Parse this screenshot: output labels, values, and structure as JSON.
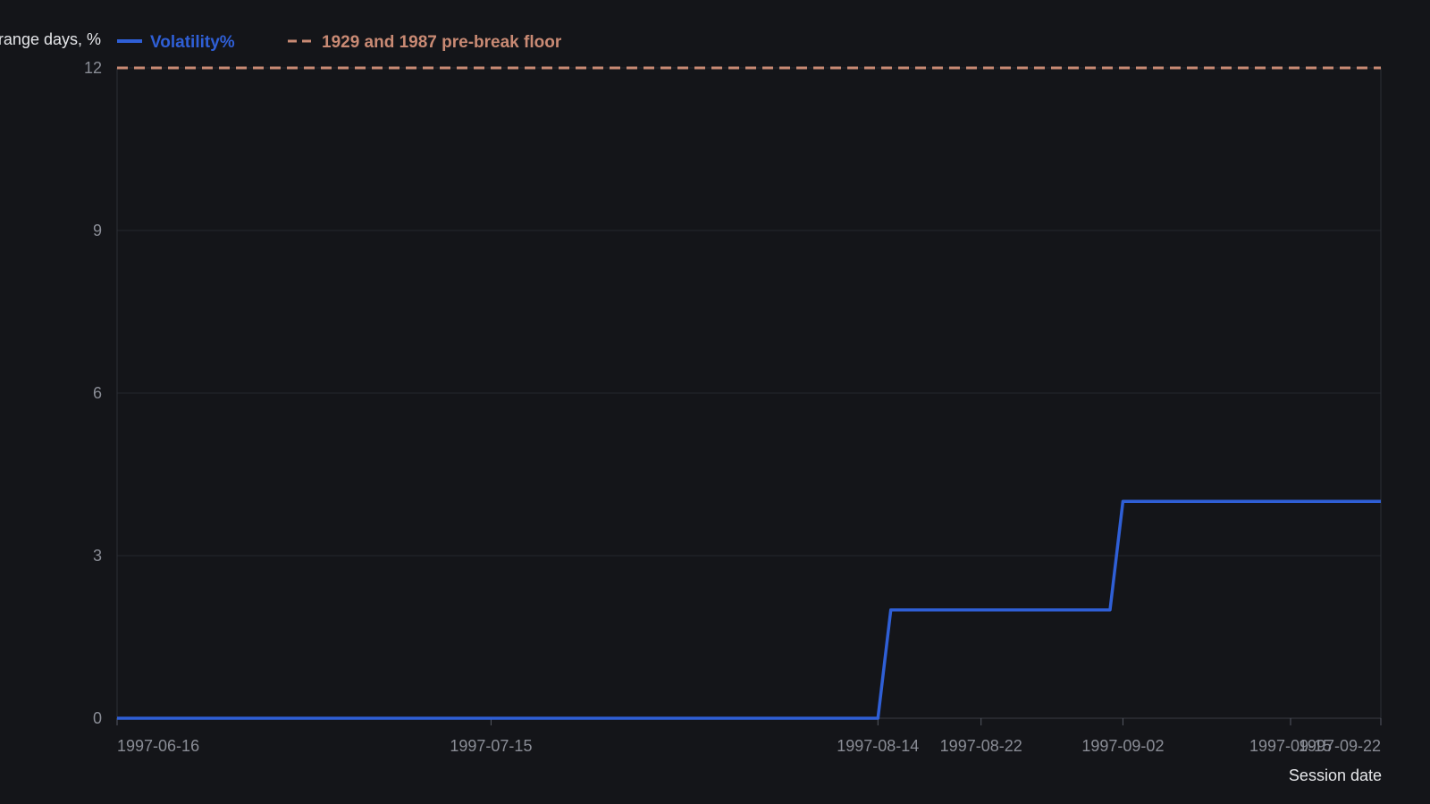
{
  "chart_data": {
    "type": "line",
    "ylabel": "Share of limit-range days, %",
    "xlabel": "Session date",
    "ylim": [
      0,
      12
    ],
    "yticks": [
      0,
      3,
      6,
      9,
      12
    ],
    "xticks": [
      "1997-06-16",
      "1997-07-15",
      "1997-08-14",
      "1997-08-22",
      "1997-09-02",
      "1997-09-15",
      "1997-09-22"
    ],
    "grid": true,
    "legend_position": "top-left",
    "step": true,
    "series": [
      {
        "name": "Volatility%",
        "color": "#2f5fd6",
        "style": "solid",
        "points": [
          {
            "x": "1997-06-16",
            "y": 0
          },
          {
            "x": "1997-08-14",
            "y": 0
          },
          {
            "x": "1997-08-15",
            "y": 2
          },
          {
            "x": "1997-09-01",
            "y": 2
          },
          {
            "x": "1997-09-02",
            "y": 4
          },
          {
            "x": "1997-09-22",
            "y": 4
          }
        ]
      }
    ],
    "reference_lines": [
      {
        "name": "1929 and 1987 pre-break floor",
        "y": 12,
        "color": "#c98a74",
        "style": "dashed"
      }
    ]
  }
}
